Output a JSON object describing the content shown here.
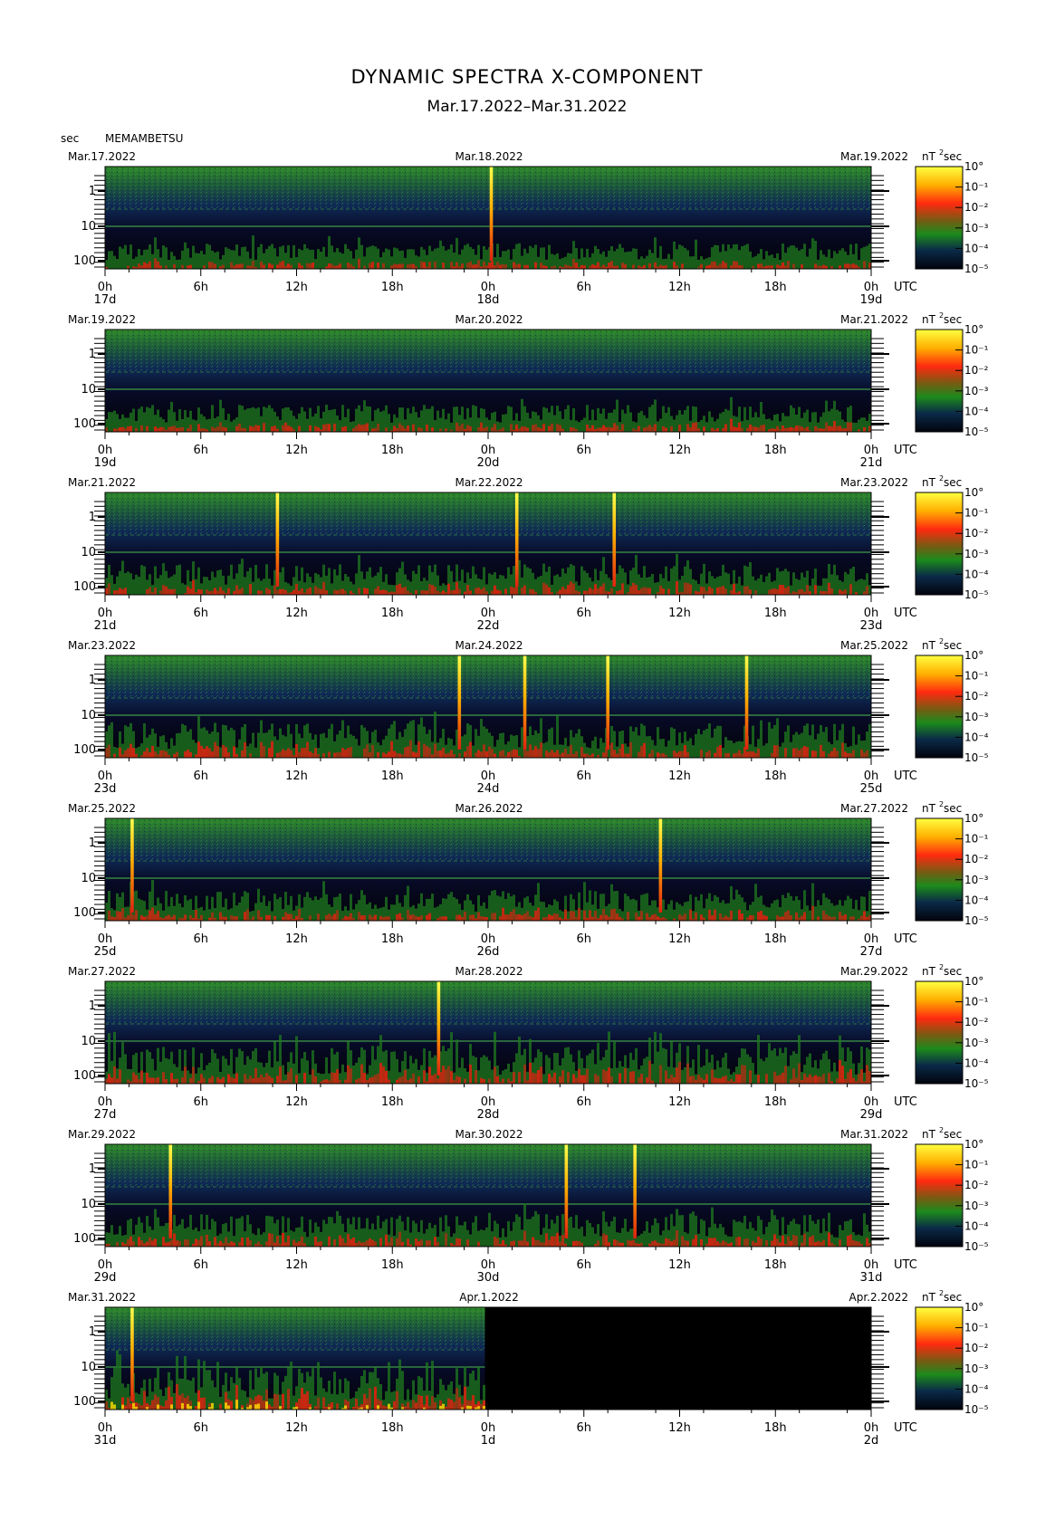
{
  "title": "DYNAMIC SPECTRA X-COMPONENT",
  "subtitle": "Mar.17.2022–Mar.31.2022",
  "yunit": "sec",
  "station": "MEMAMBETSU",
  "colorbar_unit": "nT",
  "colorbar_unit_sup": "2",
  "colorbar_unit_tail": "sec",
  "utc_label": "UTC",
  "colorbar_ticks": [
    "10°",
    "10⁻¹",
    "10⁻²",
    "10⁻³",
    "10⁻⁴",
    "10⁻⁵"
  ],
  "colors": {
    "low": "#05061a",
    "mid": "#1f7a1f",
    "high": "#e02010",
    "peak": "#ffe000"
  },
  "chart_data": {
    "type": "heatmap",
    "y_axis": {
      "label": "sec",
      "scale": "log",
      "ticks": [
        "1",
        "10",
        "100"
      ]
    },
    "x_axis": {
      "ticks": [
        "0h",
        "6h",
        "12h",
        "18h",
        "0h",
        "6h",
        "12h",
        "18h",
        "0h"
      ],
      "unit": "UTC"
    },
    "colorbar_range": [
      1e-05,
      1
    ],
    "panels": [
      {
        "left_date": "Mar.17.2022",
        "mid_date": "Mar.18.2022",
        "right_date": "Mar.19.2022",
        "day_labels": [
          "17d",
          "18d",
          "19d"
        ],
        "events_h": [
          24.2
        ],
        "data_until_h": 48,
        "activity": 0.45
      },
      {
        "left_date": "Mar.19.2022",
        "mid_date": "Mar.20.2022",
        "right_date": "Mar.21.2022",
        "day_labels": [
          "19d",
          "20d",
          "21d"
        ],
        "events_h": [],
        "data_until_h": 48,
        "activity": 0.5
      },
      {
        "left_date": "Mar.21.2022",
        "mid_date": "Mar.22.2022",
        "right_date": "Mar.23.2022",
        "day_labels": [
          "21d",
          "22d",
          "23d"
        ],
        "events_h": [
          10.8,
          25.8,
          31.9
        ],
        "data_until_h": 48,
        "activity": 0.6
      },
      {
        "left_date": "Mar.23.2022",
        "mid_date": "Mar.24.2022",
        "right_date": "Mar.25.2022",
        "day_labels": [
          "23d",
          "24d",
          "25d"
        ],
        "events_h": [
          22.2,
          26.3,
          31.5,
          40.2
        ],
        "data_until_h": 48,
        "activity": 0.7
      },
      {
        "left_date": "Mar.25.2022",
        "mid_date": "Mar.26.2022",
        "right_date": "Mar.27.2022",
        "day_labels": [
          "25d",
          "26d",
          "27d"
        ],
        "events_h": [
          1.7,
          34.8
        ],
        "data_until_h": 48,
        "activity": 0.6
      },
      {
        "left_date": "Mar.27.2022",
        "mid_date": "Mar.28.2022",
        "right_date": "Mar.29.2022",
        "day_labels": [
          "27d",
          "28d",
          "29d"
        ],
        "events_h": [
          20.9
        ],
        "data_until_h": 48,
        "activity": 0.8
      },
      {
        "left_date": "Mar.29.2022",
        "mid_date": "Mar.30.2022",
        "right_date": "Mar.31.2022",
        "day_labels": [
          "29d",
          "30d",
          "31d"
        ],
        "events_h": [
          4.1,
          28.9,
          33.2
        ],
        "data_until_h": 48,
        "activity": 0.65
      },
      {
        "left_date": "Mar.31.2022",
        "mid_date": "Apr.1.2022",
        "right_date": "Apr.2.2022",
        "day_labels": [
          "31d",
          "1d",
          "2d"
        ],
        "events_h": [
          1.7
        ],
        "data_until_h": 23.8,
        "activity": 0.95
      }
    ]
  }
}
